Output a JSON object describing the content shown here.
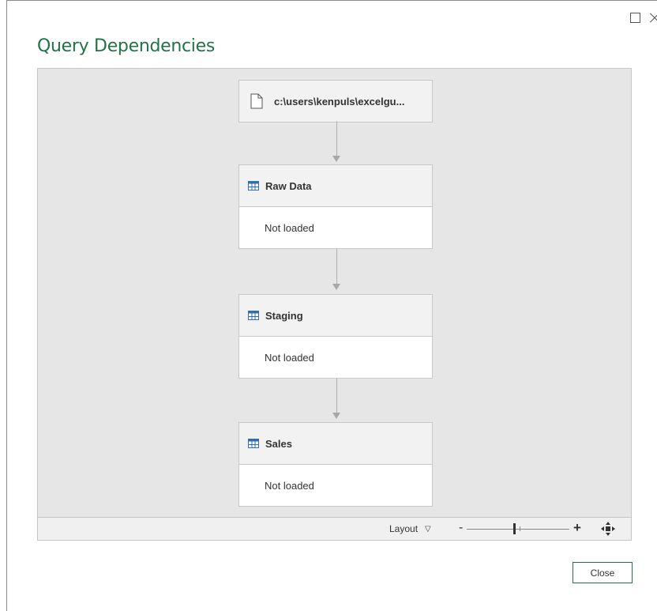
{
  "dialog": {
    "title": "Query Dependencies",
    "accent_color": "#217346"
  },
  "window_controls": {
    "maximize_icon": "maximize-icon",
    "close_icon": "close-icon"
  },
  "nodes": [
    {
      "type": "file",
      "icon": "file-icon",
      "label": "c:\\users\\kenpuls\\excelgu..."
    },
    {
      "type": "query",
      "icon": "table-icon",
      "label": "Raw Data",
      "status": "Not loaded"
    },
    {
      "type": "query",
      "icon": "table-icon",
      "label": "Staging",
      "status": "Not loaded"
    },
    {
      "type": "query",
      "icon": "table-icon",
      "label": "Sales",
      "status": "Not loaded"
    }
  ],
  "toolbar": {
    "layout_label": "Layout",
    "zoom_minus": "-",
    "zoom_plus": "+",
    "fit_icon": "fit-to-screen-icon"
  },
  "footer": {
    "close_label": "Close"
  }
}
